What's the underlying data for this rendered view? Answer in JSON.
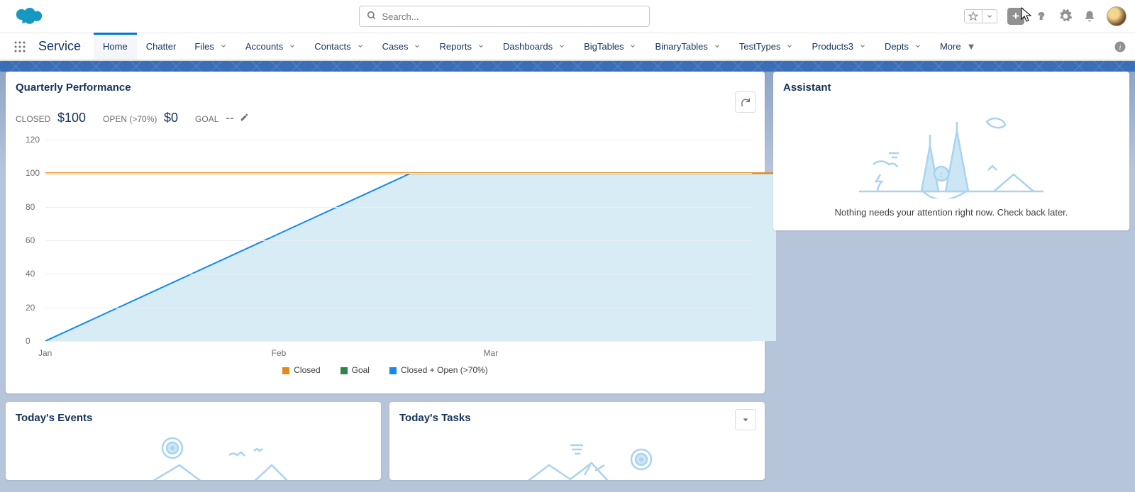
{
  "header": {
    "search_placeholder": "Search...",
    "app_name": "Service"
  },
  "nav": {
    "items": [
      {
        "label": "Home",
        "active": true,
        "dropdown": false
      },
      {
        "label": "Chatter",
        "active": false,
        "dropdown": false
      },
      {
        "label": "Files",
        "active": false,
        "dropdown": true
      },
      {
        "label": "Accounts",
        "active": false,
        "dropdown": true
      },
      {
        "label": "Contacts",
        "active": false,
        "dropdown": true
      },
      {
        "label": "Cases",
        "active": false,
        "dropdown": true
      },
      {
        "label": "Reports",
        "active": false,
        "dropdown": true
      },
      {
        "label": "Dashboards",
        "active": false,
        "dropdown": true
      },
      {
        "label": "BigTables",
        "active": false,
        "dropdown": true
      },
      {
        "label": "BinaryTables",
        "active": false,
        "dropdown": true
      },
      {
        "label": "TestTypes",
        "active": false,
        "dropdown": true
      },
      {
        "label": "Products3",
        "active": false,
        "dropdown": true
      },
      {
        "label": "Depts",
        "active": false,
        "dropdown": true
      }
    ],
    "more_label": "More"
  },
  "qp": {
    "title": "Quarterly Performance",
    "metrics": {
      "closed_label": "CLOSED",
      "closed_value": "$100",
      "open_label": "OPEN (>70%)",
      "open_value": "$0",
      "goal_label": "GOAL",
      "goal_value": "--"
    },
    "legend": {
      "closed": "Closed",
      "goal": "Goal",
      "blue": "Closed + Open (>70%)"
    },
    "colors": {
      "closed": "#e28a1b",
      "goal": "#2e844a",
      "blue": "#1589ee",
      "area": "#d7ecf4"
    }
  },
  "chart_data": {
    "type": "area",
    "title": "Quarterly Performance",
    "xlabel": "",
    "ylabel": "",
    "ylim": [
      0,
      120
    ],
    "y_ticks": [
      0,
      20,
      40,
      60,
      80,
      100,
      120
    ],
    "categories": [
      "Jan",
      "Feb",
      "Mar"
    ],
    "series": [
      {
        "name": "Closed + Open (>70%)",
        "color": "#1589ee",
        "values": [
          0,
          100,
          100
        ]
      },
      {
        "name": "Closed",
        "color": "#e28a1b",
        "values": [
          100,
          100,
          100
        ]
      },
      {
        "name": "Goal",
        "color": "#2e844a",
        "values": [
          null,
          null,
          null
        ]
      }
    ]
  },
  "events": {
    "title": "Today's Events"
  },
  "tasks": {
    "title": "Today's Tasks"
  },
  "assistant": {
    "title": "Assistant",
    "empty_text": "Nothing needs your attention right now. Check back later."
  }
}
